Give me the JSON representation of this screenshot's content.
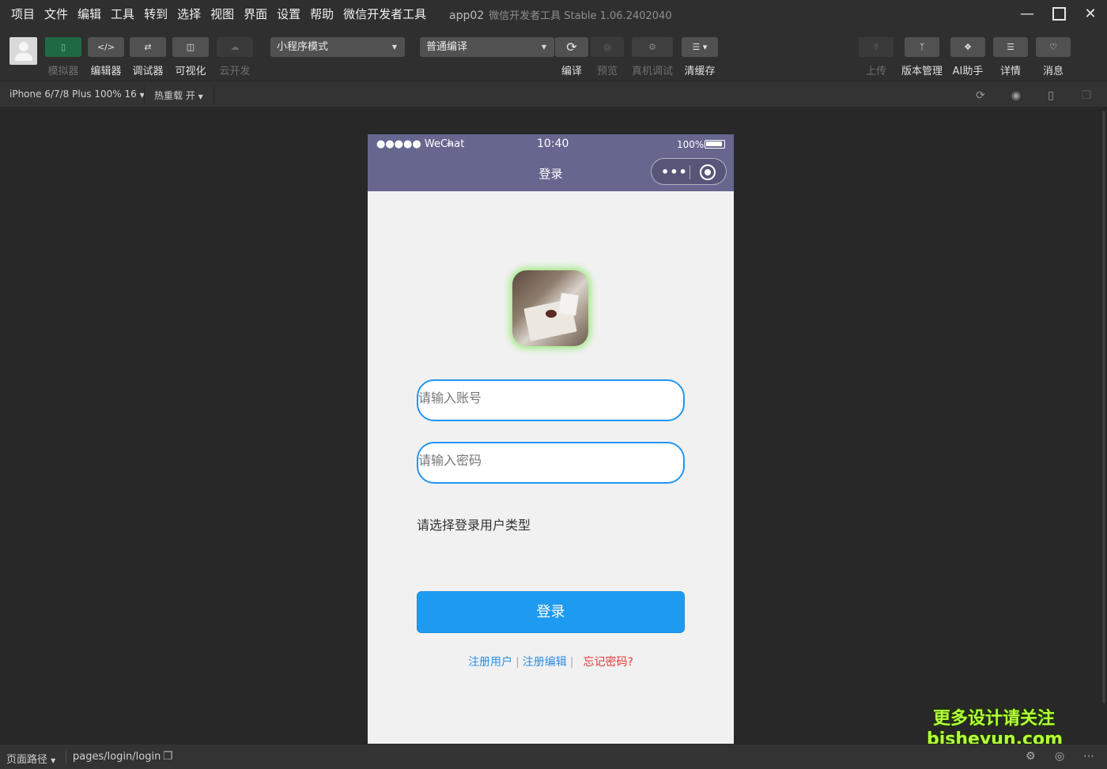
{
  "menu": [
    "项目",
    "文件",
    "编辑",
    "工具",
    "转到",
    "选择",
    "视图",
    "界面",
    "设置",
    "帮助",
    "微信开发者工具"
  ],
  "window": {
    "app": "app02",
    "title": "微信开发者工具 Stable 1.06.2402040"
  },
  "toolbar": {
    "simulator": "模拟器",
    "editor": "编辑器",
    "debugger": "调试器",
    "visual": "可视化",
    "cloud": "云开发",
    "mode_select": "小程序模式",
    "compile_select": "普通编译",
    "compile": "编译",
    "preview": "预览",
    "remote_debug": "真机调试",
    "clear_cache": "清缓存",
    "upload": "上传",
    "version": "版本管理",
    "ai": "AI助手",
    "details": "详情",
    "messages": "消息"
  },
  "subbar": {
    "device": "iPhone 6/7/8 Plus 100% 16",
    "hot_reload": "热重载 开"
  },
  "phone": {
    "carrier": "●●●●● WeChat",
    "time": "10:40",
    "battery": "100%",
    "nav_title": "登录",
    "account_placeholder": "请输入账号",
    "password_placeholder": "请输入密码",
    "type_label": "请选择登录用户类型",
    "login_button": "登录",
    "link_register_user": "注册用户",
    "link_register_editor": "注册编辑",
    "link_forgot": "忘记密码?",
    "link_sep": "|"
  },
  "watermark": {
    "line1": "更多设计请关注",
    "line2": "bisheyun.com"
  },
  "bottombar": {
    "path_label": "页面路径",
    "path": "pages/login/login"
  },
  "colors": {
    "navbar": "#67668f",
    "accent": "#1e9bf0",
    "field_border": "#2196f3",
    "forgot": "#e53935"
  }
}
